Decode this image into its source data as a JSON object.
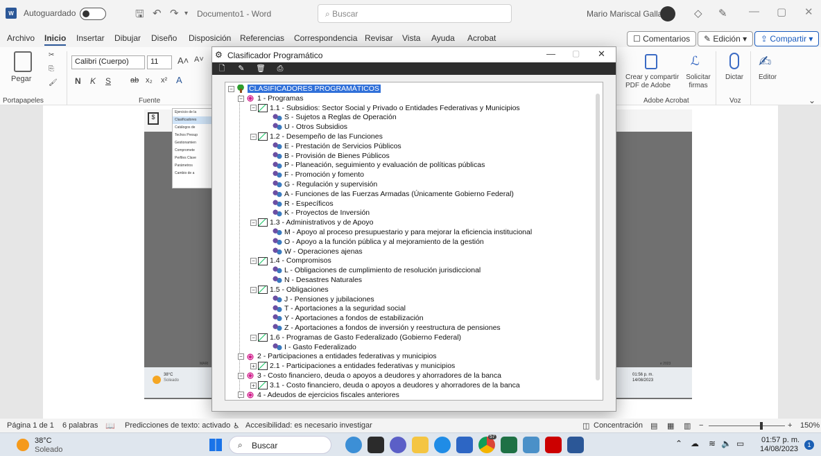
{
  "titlebar": {
    "app_badge": "W",
    "autosave_label": "Autoguardado",
    "document_title": "Documento1 - Word",
    "search_placeholder": "Buscar",
    "user_name": "Mario Mariscal Gallardo"
  },
  "menu": {
    "items": [
      "Archivo",
      "Inicio",
      "Insertar",
      "Dibujar",
      "Diseño",
      "Disposición",
      "Referencias",
      "Correspondencia",
      "Revisar",
      "Vista",
      "Ayuda",
      "Acrobat"
    ],
    "comments_label": "Comentarios",
    "editing_label": "Edición",
    "share_label": "Compartir"
  },
  "ribbon": {
    "paste_label": "Pegar",
    "font_name": "Calibri (Cuerpo)",
    "font_size": "11",
    "clipboard_group": "Portapapeles",
    "font_group": "Fuente",
    "bold": "N",
    "italic": "K",
    "underline": "S",
    "create_share_pdf": "Crear y compartir PDF de Adobe",
    "request_signatures": "Solicitar firmas",
    "adobe_group": "Adobe Acrobat",
    "dictate_label": "Dictar",
    "voice_group": "Voz",
    "editor_label": "Editor"
  },
  "embedded_image": {
    "menu_items": [
      "Ejercicio de la",
      "Clasificadores",
      "Catálogos de",
      "Techos Presup",
      "Gestionamien",
      "Compromete",
      "Perfiles Clave",
      "Parámetros",
      "Cambio de a"
    ],
    "footer_left": "MARI",
    "footer_right": "e 2023",
    "weather_temp": "38°C",
    "weather_desc": "Soleado",
    "clock_time": "01:56 p. m.",
    "clock_date": "14/08/2023"
  },
  "dialog": {
    "title": "Clasificador Programático",
    "tree": [
      {
        "level": 0,
        "icon": "tree",
        "exp": "-",
        "text": "CLASIFICADORES PROGRAMÁTICOS",
        "selected": true
      },
      {
        "level": 1,
        "icon": "gear",
        "exp": "-",
        "text": "1 - Programas"
      },
      {
        "level": 2,
        "icon": "chart",
        "exp": "-",
        "text": "1.1 - Subsidios: Sector Social y Privado o Entidades Federativas y Municipios"
      },
      {
        "level": 3,
        "icon": "people",
        "exp": "",
        "text": "S - Sujetos a Reglas de Operación"
      },
      {
        "level": 3,
        "icon": "people",
        "exp": "",
        "text": "U - Otros Subsidios"
      },
      {
        "level": 2,
        "icon": "chart",
        "exp": "-",
        "text": "1.2 - Desempeño de las Funciones"
      },
      {
        "level": 3,
        "icon": "people",
        "exp": "",
        "text": "E - Prestación de Servicios Públicos"
      },
      {
        "level": 3,
        "icon": "people",
        "exp": "",
        "text": "B - Provisión de Bienes Públicos"
      },
      {
        "level": 3,
        "icon": "people",
        "exp": "",
        "text": "P - Planeación, seguimiento y evaluación de políticas públicas"
      },
      {
        "level": 3,
        "icon": "people",
        "exp": "",
        "text": "F - Promoción y fomento"
      },
      {
        "level": 3,
        "icon": "people",
        "exp": "",
        "text": "G - Regulación y supervisión"
      },
      {
        "level": 3,
        "icon": "people",
        "exp": "",
        "text": "A - Funciones de las Fuerzas Armadas (Únicamente Gobierno Federal)"
      },
      {
        "level": 3,
        "icon": "people",
        "exp": "",
        "text": "R - Específicos"
      },
      {
        "level": 3,
        "icon": "people",
        "exp": "",
        "text": "K - Proyectos de Inversión"
      },
      {
        "level": 2,
        "icon": "chart",
        "exp": "-",
        "text": "1.3 - Administrativos y de Apoyo"
      },
      {
        "level": 3,
        "icon": "people",
        "exp": "",
        "text": "M - Apoyo al proceso presupuestario y para mejorar la eficiencia institucional"
      },
      {
        "level": 3,
        "icon": "people",
        "exp": "",
        "text": "O - Apoyo a la función pública y al mejoramiento de la gestión"
      },
      {
        "level": 3,
        "icon": "people",
        "exp": "",
        "text": "W - Operaciones ajenas"
      },
      {
        "level": 2,
        "icon": "chart",
        "exp": "-",
        "text": "1.4 - Compromisos"
      },
      {
        "level": 3,
        "icon": "people",
        "exp": "",
        "text": "L - Obligaciones de cumplimiento de resolución jurisdiccional"
      },
      {
        "level": 3,
        "icon": "people",
        "exp": "",
        "text": "N - Desastres Naturales"
      },
      {
        "level": 2,
        "icon": "chart",
        "exp": "-",
        "text": "1.5 - Obligaciones"
      },
      {
        "level": 3,
        "icon": "people",
        "exp": "",
        "text": "J - Pensiones y jubilaciones"
      },
      {
        "level": 3,
        "icon": "people",
        "exp": "",
        "text": "T - Aportaciones a la seguridad social"
      },
      {
        "level": 3,
        "icon": "people",
        "exp": "",
        "text": "Y - Aportaciones a fondos de estabilización"
      },
      {
        "level": 3,
        "icon": "people",
        "exp": "",
        "text": "Z - Aportaciones a fondos de inversión y reestructura de pensiones"
      },
      {
        "level": 2,
        "icon": "chart",
        "exp": "-",
        "text": "1.6 - Programas de Gasto Federalizado (Gobierno Federal)"
      },
      {
        "level": 3,
        "icon": "people",
        "exp": "",
        "text": "I - Gasto Federalizado"
      },
      {
        "level": 1,
        "icon": "gear",
        "exp": "-",
        "text": "2 - Participaciones a entidades federativas y municipios"
      },
      {
        "level": 2,
        "icon": "chart",
        "exp": "+",
        "text": "2.1 - Participaciones a entidades federativas y municipios"
      },
      {
        "level": 1,
        "icon": "gear",
        "exp": "-",
        "text": "3 - Costo financiero, deuda o apoyos a deudores y ahorradores de la banca"
      },
      {
        "level": 2,
        "icon": "chart",
        "exp": "+",
        "text": "3.1 - Costo financiero, deuda o apoyos a deudores y ahorradores de la banca"
      },
      {
        "level": 1,
        "icon": "gear",
        "exp": "-",
        "text": "4 - Adeudos de ejercicios fiscales anteriores"
      }
    ]
  },
  "statusbar": {
    "page": "Página 1 de 1",
    "words": "6 palabras",
    "predictions": "Predicciones de texto: activado",
    "accessibility": "Accesibilidad: es necesario investigar",
    "focus": "Concentración",
    "zoom": "150%"
  },
  "taskbar": {
    "weather_temp": "38°C",
    "weather_desc": "Soleado",
    "search_label": "Buscar",
    "time": "01:57 p. m.",
    "date": "14/08/2023",
    "notification_count": "1",
    "chrome_badge": "57"
  }
}
